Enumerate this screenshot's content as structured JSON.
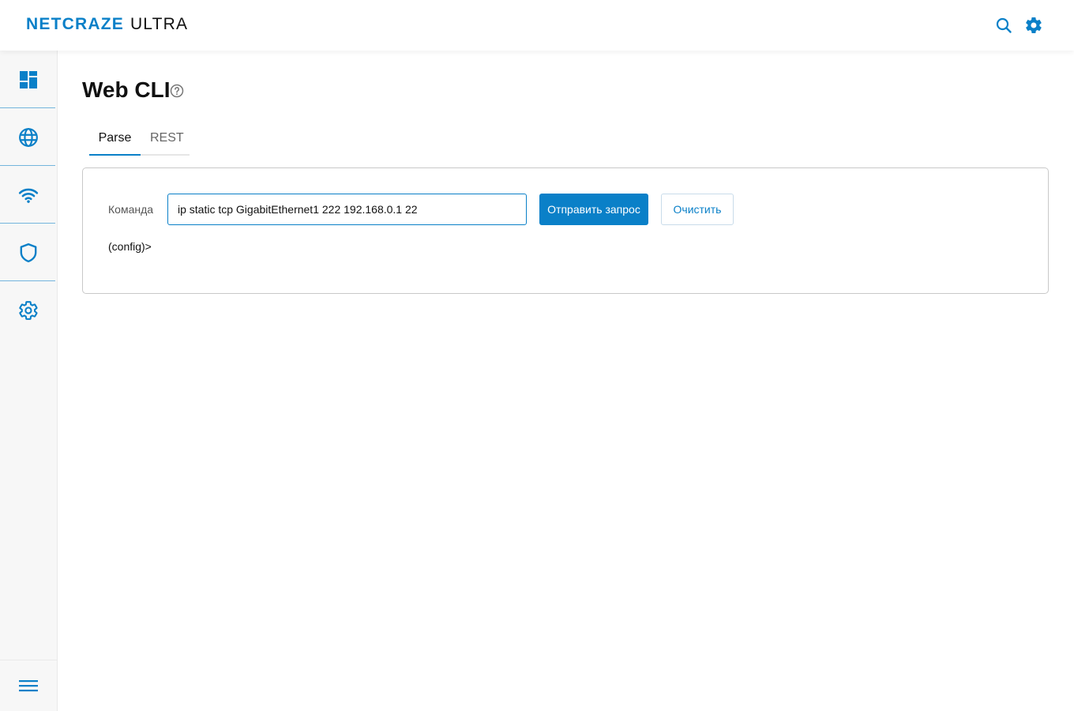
{
  "header": {
    "brand": "NETCRAZE",
    "product": "ULTRA",
    "icons": [
      "search-icon",
      "gear-icon"
    ]
  },
  "sidebar": {
    "items": [
      {
        "icon": "dashboard-icon"
      },
      {
        "icon": "globe-icon"
      },
      {
        "icon": "wifi-icon"
      },
      {
        "icon": "shield-icon"
      },
      {
        "icon": "settings-icon"
      }
    ],
    "bottom_icon": "menu-icon"
  },
  "page": {
    "title": "Web CLI",
    "help_icon": "help-circle-icon"
  },
  "tabs": [
    {
      "label": "Parse",
      "active": true
    },
    {
      "label": "REST",
      "active": false
    }
  ],
  "cli": {
    "label": "Команда",
    "input_value": "ip static tcp GigabitEthernet1 222 192.168.0.1 22",
    "send_label": "Отправить запрос",
    "clear_label": "Очистить",
    "output": "(config)>"
  },
  "colors": {
    "accent": "#0a80c8",
    "sidebar_bg": "#f7f7f7",
    "border": "#c9c9c9"
  }
}
